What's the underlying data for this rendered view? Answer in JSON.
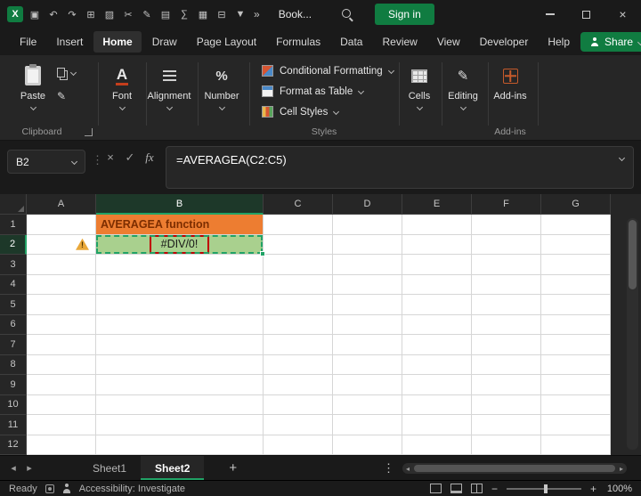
{
  "titlebar": {
    "icons": [
      "save",
      "undo",
      "redo",
      "copy",
      "paste",
      "cut",
      "format-painter",
      "chart",
      "sum",
      "table",
      "borders",
      "filter"
    ],
    "document_title": "Book...",
    "signin_label": "Sign in",
    "window_controls": [
      "minimize",
      "maximize",
      "close"
    ]
  },
  "tabs": {
    "items": [
      "File",
      "Insert",
      "Home",
      "Draw",
      "Page Layout",
      "Formulas",
      "Data",
      "Review",
      "View",
      "Developer",
      "Help"
    ],
    "active": "Home",
    "share_label": "Share"
  },
  "ribbon": {
    "paste": "Paste",
    "clipboard_group": "Clipboard",
    "font_group": "Font",
    "alignment_group": "Alignment",
    "number_group": "Number",
    "conditional_formatting": "Conditional Formatting",
    "format_as_table": "Format as Table",
    "cell_styles": "Cell Styles",
    "styles_group": "Styles",
    "cells": "Cells",
    "editing": "Editing",
    "addins": "Add-ins",
    "addins_group": "Add-ins"
  },
  "formula_bar": {
    "name_box": "B2",
    "icons": [
      "cancel",
      "enter",
      "insert-function"
    ],
    "fx_label": "fx",
    "formula": "=AVERAGEA(C2:C5)"
  },
  "grid": {
    "columns": [
      "A",
      "B",
      "C",
      "D",
      "E",
      "F",
      "G"
    ],
    "rows": [
      "1",
      "2",
      "3",
      "4",
      "5",
      "6",
      "7",
      "8",
      "9",
      "10",
      "11",
      "12"
    ],
    "selected_column": "B",
    "selected_row": "2",
    "error_indicator_cell": "A2",
    "cells": [
      {
        "ref": "B1",
        "text": "AVERAGEA function",
        "style": "title"
      },
      {
        "ref": "B2",
        "text": "#DIV/0!",
        "style": "error"
      }
    ]
  },
  "sheet_bar": {
    "tabs": [
      "Sheet1",
      "Sheet2"
    ],
    "active_tab": "Sheet2",
    "add_label": "+"
  },
  "status_bar": {
    "mode": "Ready",
    "accessibility": "Accessibility: Investigate",
    "view_icons": [
      "normal-view",
      "page-layout-view",
      "page-break-view"
    ],
    "zoom": "100%"
  },
  "colors": {
    "accent_green": "#107C41",
    "selection_green": "#21A366",
    "cell_title_fill": "#ED7D31",
    "cell_title_text": "#7C2D00",
    "cell_error_fill": "#A9D08E",
    "annotation_red": "#C00000"
  }
}
